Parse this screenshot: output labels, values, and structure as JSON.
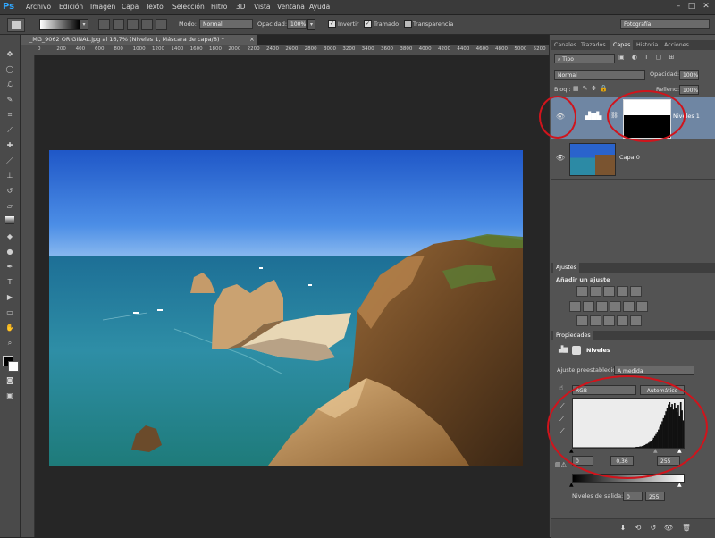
{
  "menu": {
    "logo": "Ps",
    "items": [
      "Archivo",
      "Edición",
      "Imagen",
      "Capa",
      "Texto",
      "Selección",
      "Filtro",
      "3D",
      "Vista",
      "Ventana",
      "Ayuda"
    ]
  },
  "options_bar": {
    "mode_label": "Modo:",
    "mode_value": "Normal",
    "opacity_label": "Opacidad:",
    "opacity_value": "100%",
    "invert_label": "Invertir",
    "dither_label": "Tramado",
    "transparency_label": "Transparencia",
    "workspace_value": "Fotografía"
  },
  "document": {
    "tab_title": "_MG_9062 ORIGINAL.jpg al 16,7% (Niveles 1, Máscara de capa/8) *",
    "ruler_ticks": [
      "0",
      "200",
      "400",
      "600",
      "800",
      "1000",
      "1200",
      "1400",
      "1600",
      "1800",
      "2000",
      "2200",
      "2400",
      "2600",
      "2800",
      "3000",
      "3200",
      "3400",
      "3600",
      "3800",
      "4000",
      "4200",
      "4400",
      "4600",
      "4800",
      "5000",
      "5200"
    ]
  },
  "layers_panel": {
    "tabs": [
      "Canales",
      "Trazados",
      "Capas",
      "Historia",
      "Acciones"
    ],
    "active_tab": "Capas",
    "filter_value": "Tipo",
    "blend_mode": "Normal",
    "opacity_label": "Opacidad:",
    "opacity_value": "100%",
    "lock_label": "Bloq.:",
    "fill_label": "Relleno:",
    "fill_value": "100%",
    "layers": [
      {
        "name": "Niveles 1",
        "selected": true
      },
      {
        "name": "Capa 0",
        "selected": false
      }
    ]
  },
  "adjustments_panel": {
    "title": "Ajustes",
    "subtitle": "Añadir un ajuste"
  },
  "properties_panel": {
    "title": "Propiedades",
    "type_label": "Niveles",
    "preset_label": "Ajuste preestablecido:",
    "preset_value": "A medida",
    "channel_value": "RGB",
    "auto_button": "Automático",
    "input_black": "0",
    "input_gamma": "0,36",
    "input_white": "255",
    "output_label": "Niveles de salida:",
    "output_black": "0",
    "output_white": "255",
    "histogram": [
      1,
      1,
      1,
      1,
      1,
      1,
      1,
      1,
      1,
      1,
      1,
      1,
      1,
      1,
      1,
      1,
      1,
      1,
      1,
      1,
      1,
      1,
      1,
      1,
      1,
      1,
      1,
      1,
      1,
      1,
      1,
      1,
      1,
      1,
      1,
      1,
      1,
      1,
      1,
      1,
      1,
      1,
      1,
      1,
      1,
      1,
      1,
      1,
      1,
      1,
      1,
      2,
      2,
      2,
      3,
      3,
      4,
      5,
      6,
      8,
      9,
      11,
      13,
      15,
      18,
      22,
      26,
      30,
      35,
      40,
      46,
      52,
      58,
      65,
      72,
      80,
      88,
      95,
      100,
      90,
      96,
      84,
      98,
      88,
      78,
      94,
      70,
      100,
      82,
      60
    ]
  },
  "colors": {
    "accent": "#31a8ff",
    "annotation": "#d0141c"
  }
}
